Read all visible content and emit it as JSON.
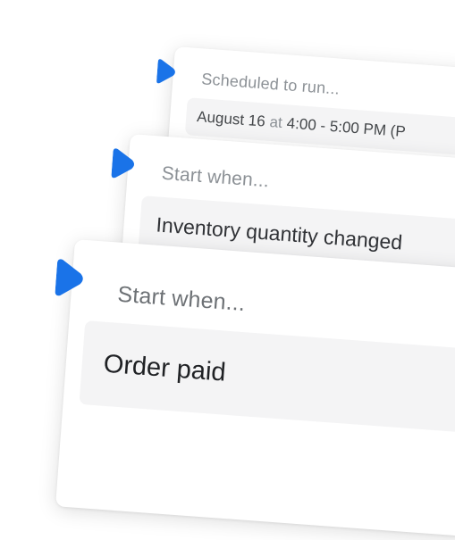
{
  "colors": {
    "accent": "#1a73e8",
    "card_bg": "#ffffff",
    "field_bg": "#f4f4f5",
    "label_text": "#8c9196",
    "value_text": "#202223"
  },
  "cards": [
    {
      "icon": "trigger-marker-icon",
      "label": "Scheduled to run...",
      "value_date": "August 16",
      "value_sep": "at",
      "value_time": "4:00 - 5:00 PM (P"
    },
    {
      "icon": "trigger-marker-icon",
      "label": "Start when...",
      "value": "Inventory quantity changed"
    },
    {
      "icon": "trigger-marker-icon",
      "label": "Start when...",
      "value": "Order paid"
    }
  ]
}
